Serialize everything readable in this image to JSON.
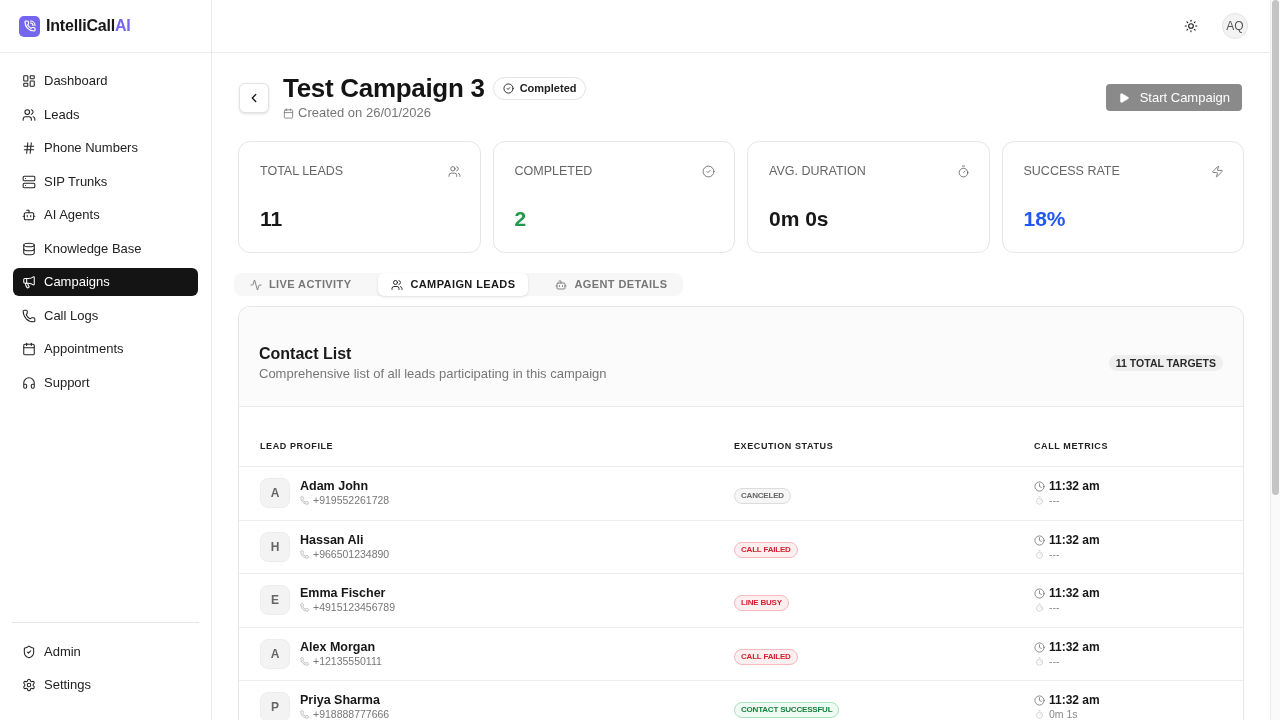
{
  "sidebar": {
    "logo": {
      "name": "IntelliCall",
      "accent": "AI"
    },
    "items": [
      {
        "label": "Dashboard",
        "selected": false
      },
      {
        "label": "Leads",
        "selected": false
      },
      {
        "label": "Phone Numbers",
        "selected": false
      },
      {
        "label": "SIP Trunks",
        "selected": false
      },
      {
        "label": "AI Agents",
        "selected": false
      },
      {
        "label": "Knowledge Base",
        "selected": false
      },
      {
        "label": "Campaigns",
        "selected": true
      },
      {
        "label": "Call Logs",
        "selected": false
      },
      {
        "label": "Appointments",
        "selected": false
      },
      {
        "label": "Support",
        "selected": false
      }
    ],
    "footer_items": [
      {
        "label": "Admin",
        "selected": false
      },
      {
        "label": "Settings",
        "selected": false
      }
    ]
  },
  "topbar": {
    "avatar": "AQ"
  },
  "header": {
    "title": "Test Campaign 3",
    "status": "Completed",
    "created": "Created on 26/01/2026",
    "action": {
      "label": "Start Campaign",
      "disabled": true
    }
  },
  "stats": [
    {
      "label": "TOTAL LEADS",
      "value": "11",
      "color": "#171717"
    },
    {
      "label": "COMPLETED",
      "value": "2",
      "color": "#1f9a4c"
    },
    {
      "label": "AVG. DURATION",
      "value": "0m 0s",
      "color": "#171717"
    },
    {
      "label": "SUCCESS RATE",
      "value": "18%",
      "color": "#2456f2"
    }
  ],
  "tabs": [
    {
      "label": "LIVE ACTIVITY",
      "selected": false
    },
    {
      "label": "CAMPAIGN LEADS",
      "selected": true
    },
    {
      "label": "AGENT DETAILS",
      "selected": false
    }
  ],
  "contact_list": {
    "title": "Contact List",
    "subtitle": "Comprehensive list of all leads participating in this campaign",
    "badge": "11 TOTAL TARGETS",
    "columns": [
      "LEAD PROFILE",
      "EXECUTION STATUS",
      "CALL METRICS"
    ],
    "rows": [
      {
        "initial": "A",
        "name": "Adam John",
        "phone": "+919552261728",
        "status": {
          "label": "CANCELED",
          "kind": "neutral"
        },
        "time": "11:32 am",
        "duration": "---"
      },
      {
        "initial": "H",
        "name": "Hassan Ali",
        "phone": "+966501234890",
        "status": {
          "label": "CALL FAILED",
          "kind": "error"
        },
        "time": "11:32 am",
        "duration": "---"
      },
      {
        "initial": "E",
        "name": "Emma Fischer",
        "phone": "+4915123456789",
        "status": {
          "label": "LINE BUSY",
          "kind": "error"
        },
        "time": "11:32 am",
        "duration": "---"
      },
      {
        "initial": "A",
        "name": "Alex Morgan",
        "phone": "+12135550111",
        "status": {
          "label": "CALL FAILED",
          "kind": "error"
        },
        "time": "11:32 am",
        "duration": "---"
      },
      {
        "initial": "P",
        "name": "Priya Sharma",
        "phone": "+918888777666",
        "status": {
          "label": "CONTACT SUCCESSFUL",
          "kind": "success"
        },
        "time": "11:32 am",
        "duration": "0m 1s"
      }
    ]
  }
}
